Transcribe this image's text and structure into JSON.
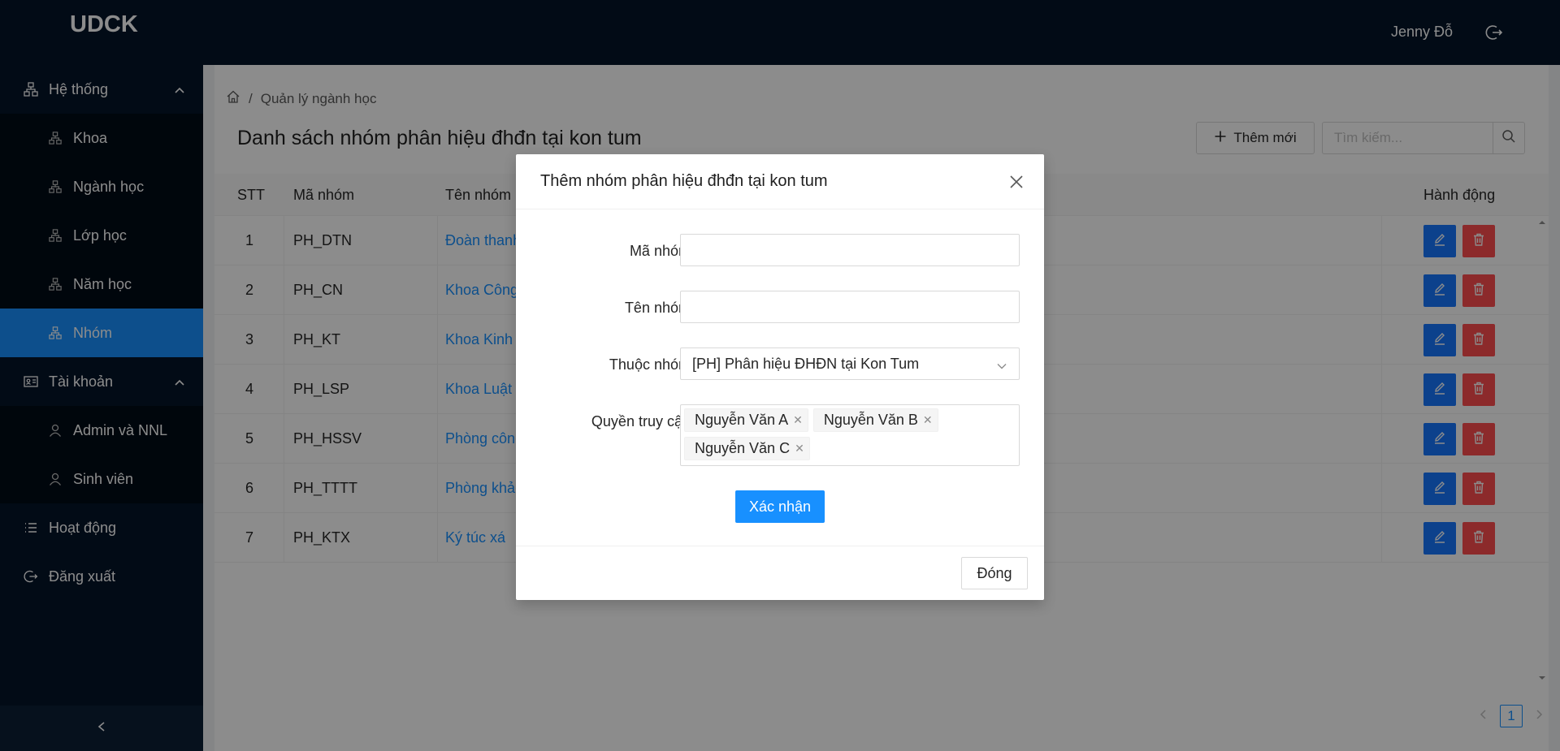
{
  "app": {
    "logo": "UDCK",
    "user_name": "Jenny Đỗ"
  },
  "sidebar": {
    "groups": [
      {
        "label": "Hệ thống",
        "icon": "cluster-icon",
        "items": [
          {
            "label": "Khoa"
          },
          {
            "label": "Ngành học"
          },
          {
            "label": "Lớp học"
          },
          {
            "label": "Năm học"
          },
          {
            "label": "Nhóm",
            "active": true
          }
        ]
      },
      {
        "label": "Tài khoản",
        "icon": "idcard-icon",
        "items": [
          {
            "label": "Admin và NNL"
          },
          {
            "label": "Sinh viên"
          }
        ]
      }
    ],
    "activity_label": "Hoạt động",
    "logout_label": "Đăng xuất"
  },
  "breadcrumb": {
    "current": "Quản lý ngành học"
  },
  "page": {
    "title": "Danh sách nhóm phân hiệu đhđn tại kon tum",
    "add_label": "Thêm mới",
    "search_placeholder": "Tìm kiếm..."
  },
  "table": {
    "columns": [
      "STT",
      "Mã nhóm",
      "Tên nhóm",
      "Hành động"
    ],
    "rows": [
      {
        "stt": "1",
        "code": "PH_DTN",
        "name": "Đoàn thanh"
      },
      {
        "stt": "2",
        "code": "PH_CN",
        "name": "Khoa Công"
      },
      {
        "stt": "3",
        "code": "PH_KT",
        "name": "Khoa Kinh t"
      },
      {
        "stt": "4",
        "code": "PH_LSP",
        "name": "Khoa Luật -"
      },
      {
        "stt": "5",
        "code": "PH_HSSV",
        "name": "Phòng công"
      },
      {
        "stt": "6",
        "code": "PH_TTTT",
        "name": "Phòng khảo"
      },
      {
        "stt": "7",
        "code": "PH_KTX",
        "name": "Ký túc xá"
      }
    ]
  },
  "pagination": {
    "current": "1"
  },
  "modal": {
    "title": "Thêm nhóm phân hiệu đhđn tại kon tum",
    "fields": {
      "code_label": "Mã nhóm",
      "code_value": "",
      "name_label": "Tên nhóm",
      "name_value": "",
      "parent_label": "Thuộc nhóm",
      "parent_value": "[PH] Phân hiệu ĐHĐN tại Kon Tum",
      "access_label": "Quyền truy cập",
      "access_tags": [
        "Nguyễn Văn A",
        "Nguyễn Văn B",
        "Nguyễn Văn C"
      ]
    },
    "submit_label": "Xác nhận",
    "close_label": "Đóng"
  },
  "colors": {
    "sidebar_bg": "#041428",
    "primary": "#1890ff",
    "danger": "#ff4d4f"
  }
}
